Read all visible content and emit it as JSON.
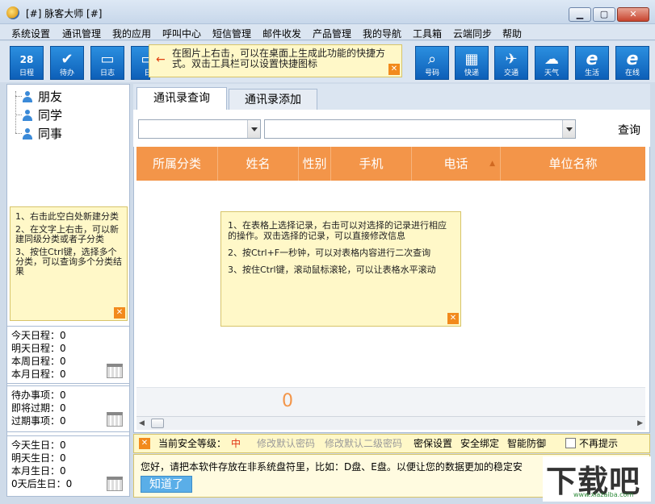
{
  "window": {
    "title": "[#] 脉客大师  [#]",
    "min": "▁",
    "max": "▢",
    "close": "✕"
  },
  "menu": [
    "系统设置",
    "通讯管理",
    "我的应用",
    "呼叫中心",
    "短信管理",
    "邮件收发",
    "产品管理",
    "我的导航",
    "工具箱",
    "云端同步",
    "帮助"
  ],
  "toolbar": {
    "items": [
      {
        "label": "日程",
        "icon": "calendar-icon",
        "glyph": "28"
      },
      {
        "label": "待办",
        "icon": "check-icon",
        "glyph": "✔"
      },
      {
        "label": "日志",
        "icon": "note-icon",
        "glyph": "▭"
      },
      {
        "label": "日",
        "icon": "note-icon",
        "glyph": "▭"
      },
      {
        "label": "号码",
        "icon": "magnifier-icon",
        "glyph": "🔍"
      },
      {
        "label": "快递",
        "icon": "film-icon",
        "glyph": "▦"
      },
      {
        "label": "交通",
        "icon": "plane-icon",
        "glyph": "✈"
      },
      {
        "label": "天气",
        "icon": "cloud-icon",
        "glyph": "☁"
      },
      {
        "label": "生活",
        "icon": "ie-icon",
        "glyph": "e"
      },
      {
        "label": "在线",
        "icon": "ie-icon",
        "glyph": "e"
      }
    ],
    "tip": "在图片上右击，可以在桌面上生成此功能的快捷方式。双击工具栏可以设置快捷图标"
  },
  "tree": [
    "朋友",
    "同学",
    "同事"
  ],
  "left_tip": [
    "1、右击此空白处新建分类",
    "2、在文字上右击，可以新建同级分类或者子分类",
    "3、按住Ctrl键，选择多个分类，可以查询多个分类结果"
  ],
  "schedule": [
    {
      "label": "今天日程：",
      "value": "0"
    },
    {
      "label": "明天日程：",
      "value": "0"
    },
    {
      "label": "本周日程：",
      "value": "0"
    },
    {
      "label": "本月日程：",
      "value": "0"
    }
  ],
  "todo": [
    {
      "label": "待办事项：",
      "value": "0"
    },
    {
      "label": "即将过期：",
      "value": "0"
    },
    {
      "label": "过期事项：",
      "value": "0"
    }
  ],
  "birthday": [
    {
      "label": "今天生日：",
      "value": "0"
    },
    {
      "label": "明天生日：",
      "value": "0"
    },
    {
      "label": "本月生日：",
      "value": "0"
    },
    {
      "label": "0天后生日：",
      "value": "0"
    }
  ],
  "tabs": [
    "通讯录查询",
    "通讯录添加"
  ],
  "search_label": "查询",
  "columns": [
    "所属分类",
    "姓名",
    "性别",
    "手机",
    "电话",
    "单位名称"
  ],
  "grid_tip": [
    "1、在表格上选择记录，右击可以对选择的记录进行相应的操作。双击选择的记录，可以直接修改信息",
    "2、按Ctrl+F一秒钟，可以对表格内容进行二次查询",
    "3、按住Ctrl键，滚动鼠标滚轮，可以让表格水平滚动"
  ],
  "record_count": "0",
  "security": {
    "level_label": "当前安全等级：",
    "level_value": "中",
    "links": [
      "修改默认密码",
      "修改默认二级密码",
      "密保设置",
      "安全绑定",
      "智能防御"
    ],
    "no_remind": "不再提示",
    "colors": {
      "level": "#e03010",
      "muted": "#9a9a9a"
    }
  },
  "notice": {
    "text": "您好，请把本软件存放在非系统盘符里，比如：D盘、E盘。以便让您的数据更加的稳定安",
    "button": "知道了"
  },
  "watermark": {
    "big": "下载吧",
    "small": "www.xiazaiba.com"
  }
}
